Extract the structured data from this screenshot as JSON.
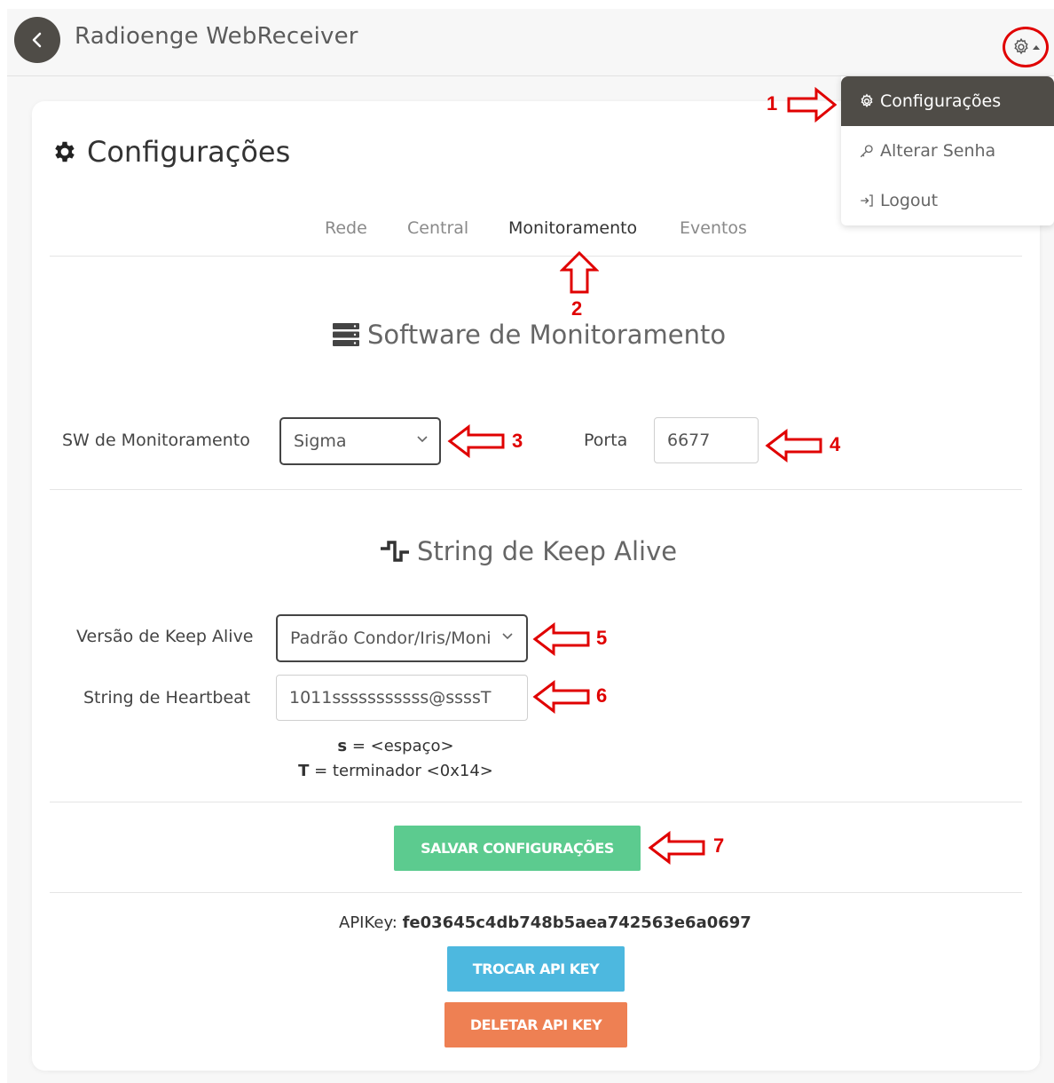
{
  "header": {
    "title": "Radioenge WebReceiver"
  },
  "user_menu": {
    "items": [
      {
        "label": "Configurações",
        "icon": "gear-icon"
      },
      {
        "label": "Alterar Senha",
        "icon": "key-icon"
      },
      {
        "label": "Logout",
        "icon": "logout-icon"
      }
    ]
  },
  "page": {
    "title": "Configurações"
  },
  "tabs": [
    {
      "label": "Rede"
    },
    {
      "label": "Central"
    },
    {
      "label": "Monitoramento"
    },
    {
      "label": "Eventos"
    }
  ],
  "monitoring": {
    "section_title": "Software de Monitoramento",
    "sw_label": "SW de Monitoramento",
    "sw_value": "Sigma",
    "port_label": "Porta",
    "port_value": "6677"
  },
  "keepalive": {
    "section_title": "String de Keep Alive",
    "version_label": "Versão de Keep Alive",
    "version_value": "Padrão Condor/Iris/Moni",
    "heartbeat_label": "String de Heartbeat",
    "heartbeat_value": "1011sssssssssss@ssssT",
    "hint_s_key": "s",
    "hint_s_text": " = <espaço>",
    "hint_t_key": "T",
    "hint_t_text": " = terminador <0x14>"
  },
  "actions": {
    "save_label": "SALVAR CONFIGURAÇÕES",
    "apikey_label": "APIKey: ",
    "apikey_value": "fe03645c4db748b5aea742563e6a0697",
    "swap_label": "TROCAR API KEY",
    "delete_label": "DELETAR API KEY"
  },
  "annotations": [
    "1",
    "2",
    "3",
    "4",
    "5",
    "6",
    "7"
  ],
  "colors": {
    "accent_dark": "#4f4c47",
    "save_green": "#5ccb8f",
    "swap_blue": "#4db8df",
    "delete_orange": "#ee8053",
    "annotation_red": "#e00000"
  }
}
